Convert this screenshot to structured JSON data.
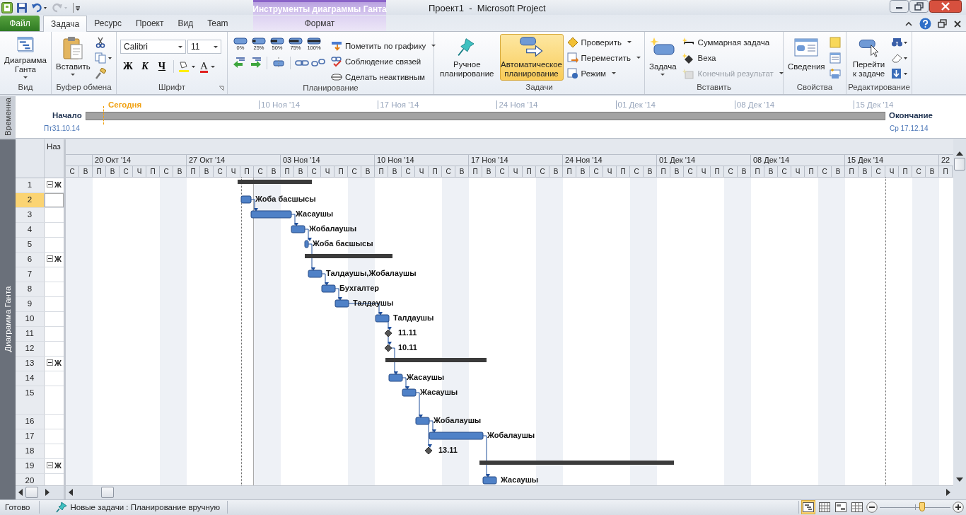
{
  "window": {
    "title": "Проект1  -  Microsoft Project"
  },
  "contextual_group": {
    "title": "Инструменты диаграммы Ганта"
  },
  "tabs": [
    {
      "label": "Файл",
      "kind": "file",
      "selected": false
    },
    {
      "label": "Задача",
      "kind": "tab",
      "selected": true
    },
    {
      "label": "Ресурс",
      "kind": "tab",
      "selected": false
    },
    {
      "label": "Проект",
      "kind": "tab",
      "selected": false
    },
    {
      "label": "Вид",
      "kind": "tab",
      "selected": false
    },
    {
      "label": "Team",
      "kind": "tab",
      "selected": false
    },
    {
      "label": "Формат",
      "kind": "contextual",
      "selected": false
    }
  ],
  "ribbon": {
    "groups": [
      {
        "title": "Вид",
        "buttons": [
          {
            "label": "Диаграмма Ганта"
          }
        ]
      },
      {
        "title": "Буфер обмена",
        "buttons": [
          {
            "label": "Вставить"
          }
        ]
      },
      {
        "title": "Шрифт",
        "font": "Calibri",
        "size": "11",
        "buttons": [
          "Ж",
          "К",
          "Ч"
        ],
        "font_color": "A"
      },
      {
        "title": "Планирование",
        "percents": [
          "0%",
          "25%",
          "50%",
          "75%",
          "100%"
        ],
        "commands": [
          "Пометить по графику",
          "Соблюдение связей",
          "Сделать неактивным"
        ]
      },
      {
        "title": "Задачи",
        "buttons": [
          {
            "label": "Ручное планирование",
            "selected": false
          },
          {
            "label": "Автоматическое планирование",
            "selected": true
          }
        ],
        "commands": [
          "Проверить",
          "Переместить",
          "Режим"
        ]
      },
      {
        "title": "Вставить",
        "buttons": [
          {
            "label": "Задача"
          }
        ],
        "commands": [
          {
            "label": "Суммарная задача",
            "disabled": false
          },
          {
            "label": "Веха",
            "disabled": false
          },
          {
            "label": "Конечный результат",
            "disabled": true
          }
        ]
      },
      {
        "title": "Свойства",
        "buttons": [
          {
            "label": "Сведения"
          }
        ]
      },
      {
        "title": "Редактирование",
        "buttons": [
          {
            "label": "Перейти к задаче"
          }
        ]
      }
    ]
  },
  "timeline": {
    "label": "Временна",
    "today": "Сегодня",
    "start_label": "Начало",
    "start_date": "Пт31.10.14",
    "finish_label": "Окончание",
    "finish_date": "Ср 17.12.14",
    "ticks": [
      "10 Ноя '14",
      "17 Ноя '14",
      "24 Ноя '14",
      "01 Дек '14",
      "08 Дек '14",
      "15 Дек '14"
    ]
  },
  "gantt": {
    "view_label": "Диаграмма Ганта",
    "name_header": "Наз",
    "weeks": [
      "20 Окт '14",
      "27 Окт '14",
      "03 Ноя '14",
      "10 Ноя '14",
      "17 Ноя '14",
      "24 Ноя '14",
      "01 Дек '14",
      "08 Дек '14",
      "15 Дек '14",
      "22"
    ],
    "days": [
      "С",
      "В",
      "П",
      "В",
      "С",
      "Ч",
      "П",
      "С",
      "В",
      "П",
      "В",
      "С",
      "Ч",
      "П",
      "С",
      "В",
      "П",
      "В",
      "С",
      "Ч",
      "П",
      "С",
      "В",
      "П",
      "В",
      "С",
      "Ч",
      "П",
      "С",
      "В",
      "П",
      "В",
      "С",
      "Ч",
      "П",
      "С",
      "В",
      "П",
      "В",
      "С",
      "Ч",
      "П",
      "С",
      "В",
      "П",
      "В",
      "С",
      "Ч",
      "П",
      "С",
      "В",
      "П",
      "В",
      "С",
      "Ч",
      "П",
      "С",
      "В",
      "П",
      "В",
      "С",
      "Ч",
      "П",
      "С",
      "В",
      "П"
    ],
    "rows": [
      {
        "id": "1",
        "kind": "summary",
        "name": "Ж",
        "selected": false
      },
      {
        "id": "2",
        "kind": "task",
        "label": "Жоба басшысы",
        "selected": true
      },
      {
        "id": "3",
        "kind": "task",
        "label": "Жасаушы",
        "selected": false
      },
      {
        "id": "4",
        "kind": "task",
        "label": "Жобалаушы",
        "selected": false
      },
      {
        "id": "5",
        "kind": "task",
        "label": "Жоба басшысы",
        "selected": false
      },
      {
        "id": "6",
        "kind": "summary",
        "name": "Ж",
        "selected": false
      },
      {
        "id": "7",
        "kind": "task",
        "label": "Талдаушы,Жобалаушы",
        "selected": false
      },
      {
        "id": "8",
        "kind": "task",
        "label": "Бухгалтер",
        "selected": false
      },
      {
        "id": "9",
        "kind": "task",
        "label": "Талдаушы",
        "selected": false
      },
      {
        "id": "10",
        "kind": "task",
        "label": "Талдаушы",
        "selected": false
      },
      {
        "id": "11",
        "kind": "milestone",
        "label": "11.11",
        "selected": false
      },
      {
        "id": "12",
        "kind": "milestone",
        "label": "10.11",
        "selected": false
      },
      {
        "id": "13",
        "kind": "summary",
        "name": "Ж",
        "selected": false
      },
      {
        "id": "14",
        "kind": "task",
        "label": "Жасаушы",
        "selected": false
      },
      {
        "id": "15",
        "kind": "task",
        "label": "Жасаушы",
        "selected": false
      },
      {
        "id": "16",
        "kind": "task",
        "label": "Жобалаушы",
        "selected": false
      },
      {
        "id": "17",
        "kind": "task",
        "label": "Жобалаушы",
        "selected": false
      },
      {
        "id": "18",
        "kind": "milestone",
        "label": "13.11",
        "selected": false
      },
      {
        "id": "19",
        "kind": "summary",
        "name": "Ж",
        "selected": false
      },
      {
        "id": "20",
        "kind": "task",
        "label": "Жасаушы",
        "selected": false
      }
    ]
  },
  "status_bar": {
    "ready": "Готово",
    "new_tasks": "Новые задачи : Планирование вручную",
    "views": [
      {
        "selected": true
      },
      {
        "selected": false
      },
      {
        "selected": false
      },
      {
        "selected": false
      }
    ],
    "zoom": {
      "level": 0.6
    }
  }
}
